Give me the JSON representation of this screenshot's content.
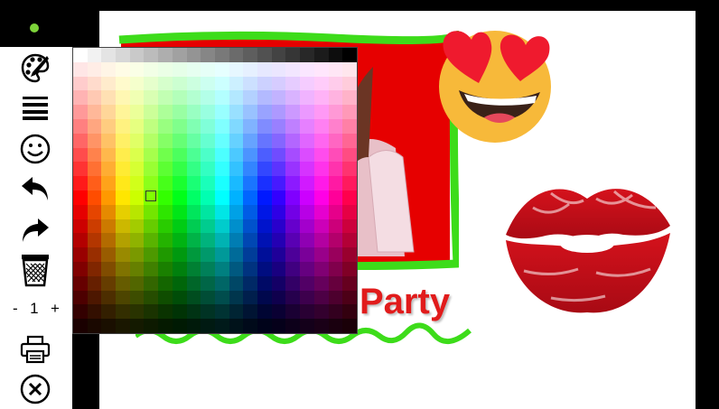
{
  "toolbar": {
    "icons": {
      "brush": "paint-brush-palette-icon",
      "lines": "line-width-icon",
      "smiley": "smiley-icon",
      "undo": "undo-arrow-icon",
      "redo": "redo-arrow-icon",
      "trash": "trash-bin-icon",
      "print": "printer-icon",
      "close": "close-circle-icon"
    },
    "size_minus": "-",
    "size_value": "1",
    "size_plus": "+",
    "status_color": "#7dd33a"
  },
  "canvas": {
    "photo_label": "Party",
    "frame_color": "#3ddc1a",
    "photo_bg": "#e60000",
    "stickers": [
      "heart-eyes-emoji",
      "red-lips-kiss"
    ]
  },
  "color_picker": {
    "grid_columns": 20,
    "grid_rows": 20
  }
}
